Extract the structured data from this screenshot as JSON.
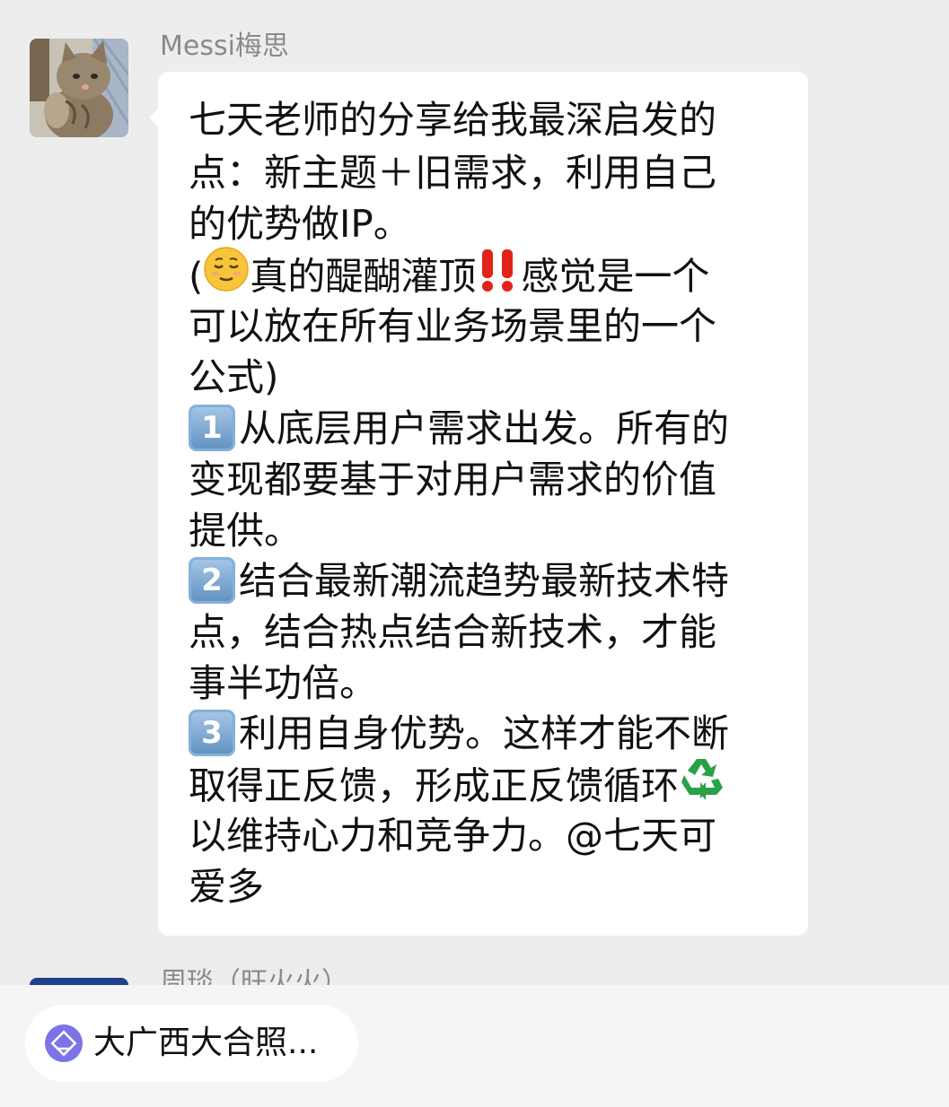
{
  "message": {
    "sender_name": "Messi梅思",
    "lines": [
      " 七天老师的分享给我最深启发的",
      "点：新主题＋旧需求，利用自己",
      "的优势做IP。",
      {
        "pre": "(",
        "emoji1": "relieved-face-emoji",
        "mid": "真的醍醐灌顶",
        "emoji2": "double-exclamation-emoji",
        "post": "感觉是一个"
      },
      "可以放在所有业务场景里的一个",
      "公式)",
      {
        "key": "1",
        "text": "从底层用户需求出发。所有的"
      },
      "变现都要基于对用户需求的价值",
      "提供。",
      {
        "key": "2",
        "text": "结合最新潮流趋势最新技术特"
      },
      "点，结合热点结合新技术，才能",
      "事半功倍。",
      {
        "key": "3",
        "text": "利用自身优势。这样才能不断"
      },
      {
        "text": "取得正反馈，形成正反馈循环",
        "emoji": "recycling-symbol-emoji"
      },
      "以维持心力和竞争力。@七天可",
      "爱多"
    ]
  },
  "next_message": {
    "sender_name": "周琰（旺火火）"
  },
  "bottom_bar": {
    "pill_icon": "mini-program-icon",
    "pill_label": "大广西大合照..."
  },
  "colors": {
    "background": "#ededed",
    "bubble": "#ffffff",
    "sender_text": "#8a8a8a",
    "pill_icon": "#7b74e6"
  }
}
